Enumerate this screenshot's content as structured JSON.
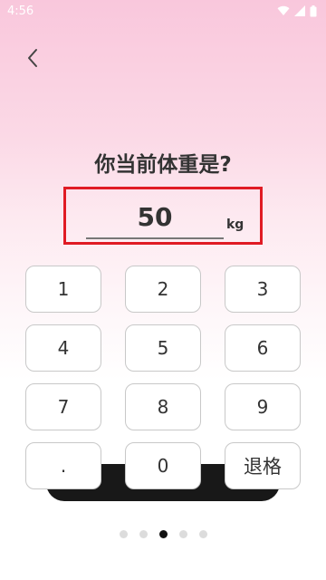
{
  "status_bar": {
    "time": "4:56",
    "icons": [
      "wifi-icon",
      "signal-icon",
      "battery-icon"
    ]
  },
  "header": {
    "back_icon": "chevron-left-icon"
  },
  "question": {
    "title": "你当前体重是?"
  },
  "weight": {
    "value": "50",
    "unit": "kg"
  },
  "keypad": {
    "keys": [
      "1",
      "2",
      "3",
      "4",
      "5",
      "6",
      "7",
      "8",
      "9",
      ".",
      "0",
      "退格"
    ]
  },
  "pager": {
    "total": 5,
    "active_index": 2
  },
  "colors": {
    "highlight_border": "#e01b24",
    "gradient_top": "#f9c7dc",
    "active_dot": "#111111",
    "inactive_dot": "#dcdcdc"
  }
}
